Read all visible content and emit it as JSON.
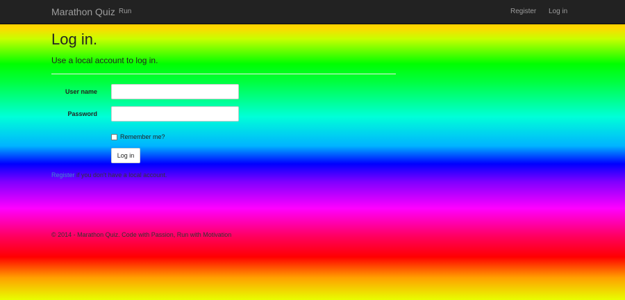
{
  "navbar": {
    "brand": "Marathon Quiz",
    "links": [
      "Run"
    ],
    "right_links": [
      "Register",
      "Log in"
    ]
  },
  "main": {
    "title": "Log in.",
    "subtitle": "Use a local account to log in.",
    "username_label": "User name",
    "username_value": "",
    "password_label": "Password",
    "password_value": "",
    "remember_label": "Remember me?",
    "remember_checked": false,
    "submit_label": "Log in",
    "register_link": "Register",
    "register_suffix": " if you don't have a local account."
  },
  "footer": {
    "text": "© 2014 - Marathon Quiz. Code with Passion, Run with Motivation"
  },
  "colors": {
    "navbar_bg": "#222222",
    "nav_text": "#9d9d9d",
    "link": "#428bca"
  }
}
